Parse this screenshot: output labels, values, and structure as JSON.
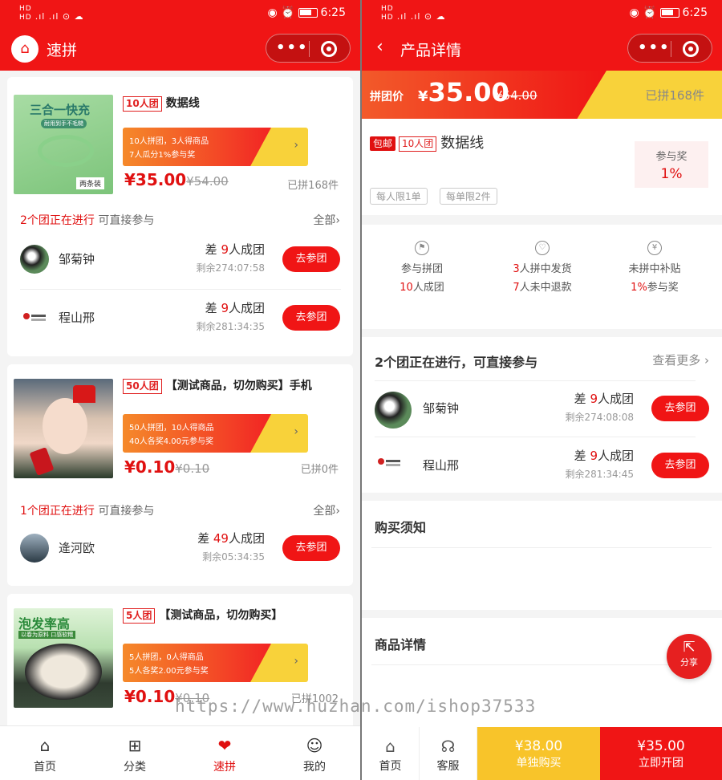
{
  "status_bar": {
    "left": "HD 4G HD 4G",
    "time": "6:25"
  },
  "left_screen": {
    "title": "速拼",
    "products": [
      {
        "team_tag": "10人团",
        "name": "数据线",
        "img_text": "三合一快充",
        "img_sub": "耐用到手不毛糙",
        "img_tag": "两条装",
        "promo_line1": "10人拼团，3人得商品",
        "promo_line2": "7人瓜分1%参与奖",
        "price": "¥35.00",
        "old_price": "¥54.00",
        "sold": "已拼168件",
        "groups_count": "2个团正在进行",
        "groups_suffix": "可直接参与",
        "all_label": "全部",
        "members": [
          {
            "name": "邹菊钟",
            "need_pre": "差",
            "need_num": "9",
            "need_post": "人成团",
            "remain": "剩余274:07:58",
            "btn": "去参团"
          },
          {
            "name": "程山邢",
            "need_pre": "差",
            "need_num": "9",
            "need_post": "人成团",
            "remain": "剩余281:34:35",
            "btn": "去参团"
          }
        ]
      },
      {
        "team_tag": "50人团",
        "name": "【测试商品，切勿购买】手机",
        "promo_line1": "50人拼团，10人得商品",
        "promo_line2": "40人各奖4.00元参与奖",
        "price": "¥0.10",
        "old_price": "¥0.10",
        "sold": "已拼0件",
        "groups_count": "1个团正在进行",
        "groups_suffix": "可直接参与",
        "all_label": "全部",
        "members": [
          {
            "name": "逄河欧",
            "need_pre": "差",
            "need_num": "49",
            "need_post": "人成团",
            "remain": "剩余05:34:35",
            "btn": "去参团"
          }
        ]
      },
      {
        "team_tag": "5人团",
        "name": "【测试商品，切勿购买】",
        "img_text": "泡发率高",
        "img_sub": "以春为原料 口感软糯",
        "promo_line1": "5人拼团，0人得商品",
        "promo_line2": "5人各奖2.00元参与奖",
        "price": "¥0.10",
        "old_price": "¥0.10",
        "sold": "已拼1002"
      }
    ],
    "tabbar": [
      {
        "label": "首页",
        "icon": "home-icon"
      },
      {
        "label": "分类",
        "icon": "grid-icon"
      },
      {
        "label": "速拼",
        "icon": "heart-icon"
      },
      {
        "label": "我的",
        "icon": "smile-icon"
      }
    ]
  },
  "right_screen": {
    "title": "产品详情",
    "price_label": "拼团价",
    "price_currency": "¥",
    "price": "35.00",
    "old_price": "¥54.00",
    "sold": "已拼168件",
    "free_shipping": "包邮",
    "team_tag": "10人团",
    "name": "数据线",
    "limit_person": "每人限1单",
    "limit_order": "每单限2件",
    "award_label": "参与奖",
    "award_value": "1%",
    "rules": [
      {
        "line1": "参与拼团",
        "line2_num": "10",
        "line2_text": "人成团",
        "icon": "flag-icon"
      },
      {
        "line1_num": "3",
        "line1_text": "人拼中发货",
        "line2_num": "7",
        "line2_text": "人未中退款",
        "icon": "heart-outline-icon"
      },
      {
        "line1": "未拼中补贴",
        "line2_num": "1%",
        "line2_text": "参与奖",
        "icon": "yen-icon"
      }
    ],
    "groups_title": "2个团正在进行，可直接参与",
    "more_label": "查看更多",
    "members": [
      {
        "name": "邹菊钟",
        "need_pre": "差",
        "need_num": "9",
        "need_post": "人成团",
        "remain": "剩余274:08:08",
        "btn": "去参团"
      },
      {
        "name": "程山邢",
        "need_pre": "差",
        "need_num": "9",
        "need_post": "人成团",
        "remain": "剩余281:34:45",
        "btn": "去参团"
      }
    ],
    "purchase_notice": "购买须知",
    "product_detail": "商品详情",
    "share_label": "分享",
    "bottom": {
      "home": "首页",
      "service": "客服",
      "single_price": "¥38.00",
      "single_label": "单独购买",
      "group_price": "¥35.00",
      "group_label": "立即开团"
    }
  },
  "watermark": "https://www.huzhan.com/ishop37533",
  "colors": {
    "primary_red": "#f01515",
    "accent_yellow": "#f8d23a"
  }
}
